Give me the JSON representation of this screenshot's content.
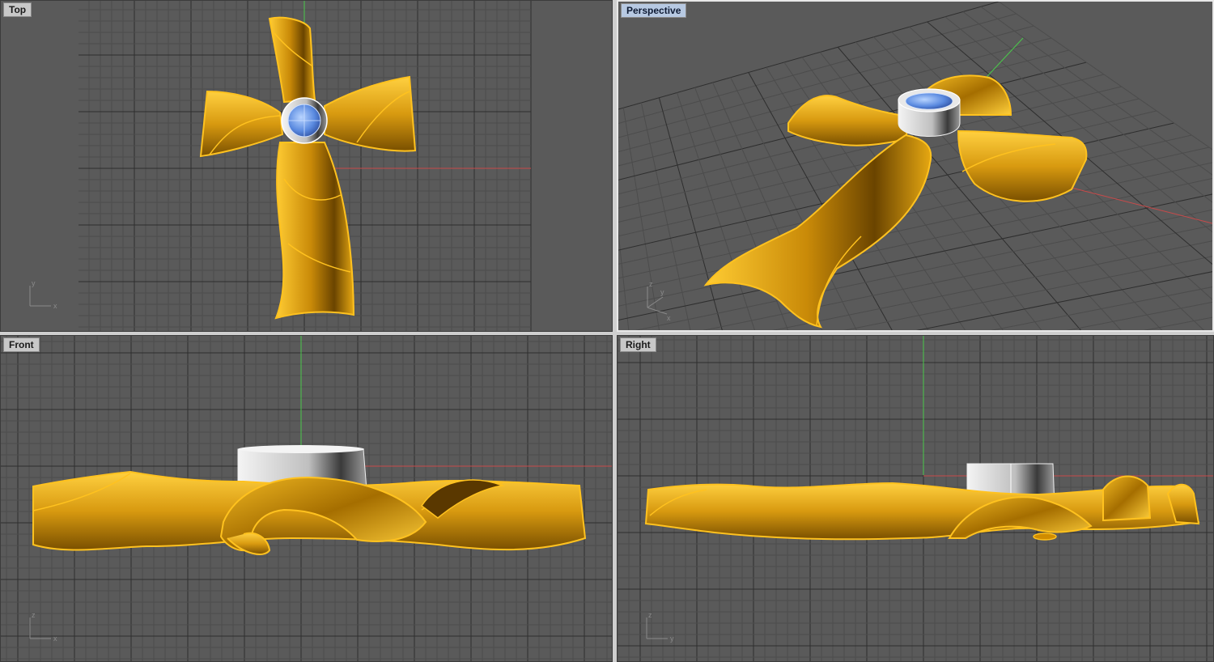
{
  "viewports": {
    "top": {
      "label": "Top",
      "axis_a": "y",
      "axis_b": "x"
    },
    "perspective": {
      "label": "Perspective",
      "axis_a": "z",
      "axis_b": "y",
      "axis_c": "x"
    },
    "front": {
      "label": "Front",
      "axis_a": "z",
      "axis_b": "x"
    },
    "right": {
      "label": "Right",
      "axis_a": "z",
      "axis_b": "y"
    }
  },
  "colors": {
    "background": "#5a5a5a",
    "grid_minor": "#4c4c4c",
    "grid_major": "#2e2e2e",
    "x_axis": "#c84a4a",
    "y_axis": "#4ac84a",
    "model_gold": "#e0a010",
    "model_edge": "#ffc21f",
    "silver": "#d8d8d8",
    "gem": "#6a9ae8"
  }
}
